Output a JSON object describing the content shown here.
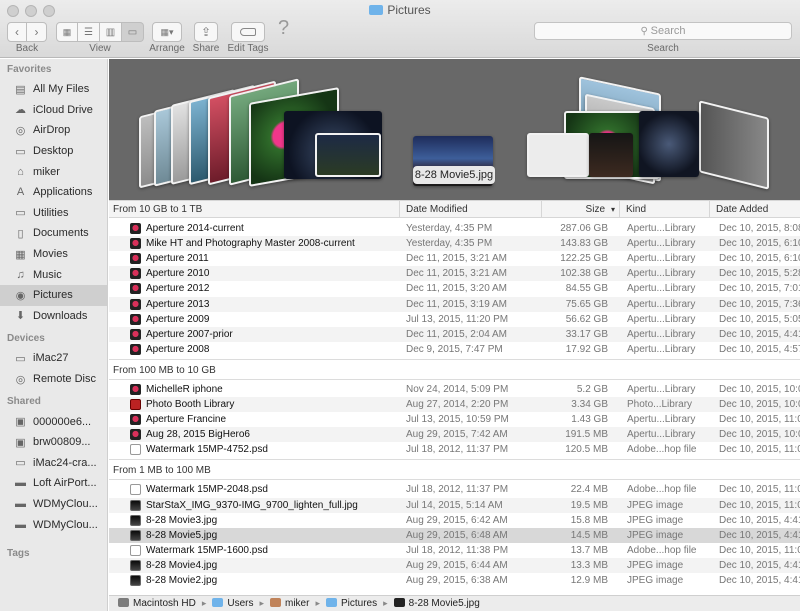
{
  "window": {
    "title": "Pictures"
  },
  "toolbar": {
    "back_label": "Back",
    "view_label": "View",
    "arrange_label": "Arrange",
    "share_label": "Share",
    "edit_tags_label": "Edit Tags",
    "help_glyph": "?",
    "search_placeholder": "Search",
    "search_label": "Search"
  },
  "sidebar": {
    "favorites_title": "Favorites",
    "favorites": [
      {
        "label": "All My Files",
        "icon": "all-files-icon"
      },
      {
        "label": "iCloud Drive",
        "icon": "cloud-icon"
      },
      {
        "label": "AirDrop",
        "icon": "airdrop-icon"
      },
      {
        "label": "Desktop",
        "icon": "desktop-icon"
      },
      {
        "label": "miker",
        "icon": "home-icon"
      },
      {
        "label": "Applications",
        "icon": "applications-icon"
      },
      {
        "label": "Utilities",
        "icon": "folder-icon"
      },
      {
        "label": "Documents",
        "icon": "documents-icon"
      },
      {
        "label": "Movies",
        "icon": "movies-icon"
      },
      {
        "label": "Music",
        "icon": "music-icon"
      },
      {
        "label": "Pictures",
        "icon": "camera-icon",
        "selected": true
      },
      {
        "label": "Downloads",
        "icon": "download-icon"
      }
    ],
    "devices_title": "Devices",
    "devices": [
      {
        "label": "iMac27",
        "icon": "imac-icon"
      },
      {
        "label": "Remote Disc",
        "icon": "disc-icon"
      }
    ],
    "shared_title": "Shared",
    "shared": [
      {
        "label": "000000e6...",
        "icon": "network-pc-icon"
      },
      {
        "label": "brw00809...",
        "icon": "network-pc-icon"
      },
      {
        "label": "iMac24-cra...",
        "icon": "network-imac-icon"
      },
      {
        "label": "Loft AirPort...",
        "icon": "network-device-icon"
      },
      {
        "label": "WDMyClou...",
        "icon": "network-device-icon"
      },
      {
        "label": "WDMyClou...",
        "icon": "network-device-icon"
      }
    ],
    "tags_title": "Tags"
  },
  "coverflow": {
    "caption": "8-28 Movie5.jpg"
  },
  "columns": {
    "name": "From 10 GB to 1 TB",
    "date": "Date Modified",
    "size": "Size",
    "kind": "Kind",
    "added": "Date Added"
  },
  "groups": [
    {
      "title": "From 10 GB to 1 TB",
      "rows": [
        {
          "name": "Aperture 2014-current",
          "date": "Yesterday, 4:35 PM",
          "size": "287.06 GB",
          "kind": "Apertu...Library",
          "added": "Dec 10, 2015, 8:08",
          "icon": "ap"
        },
        {
          "name": "Mike HT and Photography Master 2008-current",
          "date": "Yesterday, 4:35 PM",
          "size": "143.83 GB",
          "kind": "Apertu...Library",
          "added": "Dec 10, 2015, 6:10",
          "icon": "ap"
        },
        {
          "name": "Aperture 2011",
          "date": "Dec 11, 2015, 3:21 AM",
          "size": "122.25 GB",
          "kind": "Apertu...Library",
          "added": "Dec 10, 2015, 6:10",
          "icon": "ap"
        },
        {
          "name": "Aperture 2010",
          "date": "Dec 11, 2015, 3:21 AM",
          "size": "102.38 GB",
          "kind": "Apertu...Library",
          "added": "Dec 10, 2015, 5:28",
          "icon": "ap"
        },
        {
          "name": "Aperture 2012",
          "date": "Dec 11, 2015, 3:20 AM",
          "size": "84.55 GB",
          "kind": "Apertu...Library",
          "added": "Dec 10, 2015, 7:01",
          "icon": "ap"
        },
        {
          "name": "Aperture 2013",
          "date": "Dec 11, 2015, 3:19 AM",
          "size": "75.65 GB",
          "kind": "Apertu...Library",
          "added": "Dec 10, 2015, 7:36",
          "icon": "ap"
        },
        {
          "name": "Aperture 2009",
          "date": "Jul 13, 2015, 11:20 PM",
          "size": "56.62 GB",
          "kind": "Apertu...Library",
          "added": "Dec 10, 2015, 5:05",
          "icon": "ap"
        },
        {
          "name": "Aperture 2007-prior",
          "date": "Dec 11, 2015, 2:04 AM",
          "size": "33.17 GB",
          "kind": "Apertu...Library",
          "added": "Dec 10, 2015, 4:41",
          "icon": "ap"
        },
        {
          "name": "Aperture 2008",
          "date": "Dec 9, 2015, 7:47 PM",
          "size": "17.92 GB",
          "kind": "Apertu...Library",
          "added": "Dec 10, 2015, 4:57",
          "icon": "ap"
        }
      ]
    },
    {
      "title": "From 100 MB to 10 GB",
      "rows": [
        {
          "name": "MichelleR iphone",
          "date": "Nov 24, 2014, 5:09 PM",
          "size": "5.2 GB",
          "kind": "Apertu...Library",
          "added": "Dec 10, 2015, 10:0",
          "icon": "ap"
        },
        {
          "name": "Photo Booth Library",
          "date": "Aug 27, 2014, 2:20 PM",
          "size": "3.34 GB",
          "kind": "Photo...Library",
          "added": "Dec 10, 2015, 10:0",
          "icon": "pb"
        },
        {
          "name": "Aperture Francine",
          "date": "Jul 13, 2015, 10:59 PM",
          "size": "1.43 GB",
          "kind": "Apertu...Library",
          "added": "Dec 10, 2015, 11:0",
          "icon": "ap"
        },
        {
          "name": "Aug 28, 2015 BigHero6",
          "date": "Aug 29, 2015, 7:42 AM",
          "size": "191.5 MB",
          "kind": "Apertu...Library",
          "added": "Dec 10, 2015, 10:0",
          "icon": "ap"
        },
        {
          "name": "Watermark 15MP-4752.psd",
          "date": "Jul 18, 2012, 11:37 PM",
          "size": "120.5 MB",
          "kind": "Adobe...hop file",
          "added": "Dec 10, 2015, 11:0",
          "icon": "doc"
        }
      ]
    },
    {
      "title": "From 1 MB to 100 MB",
      "rows": [
        {
          "name": "Watermark 15MP-2048.psd",
          "date": "Jul 18, 2012, 11:37 PM",
          "size": "22.4 MB",
          "kind": "Adobe...hop file",
          "added": "Dec 10, 2015, 11:0",
          "icon": "doc"
        },
        {
          "name": "StarStaX_IMG_9370-IMG_9700_lighten_full.jpg",
          "date": "Jul 14, 2015, 5:14 AM",
          "size": "19.5 MB",
          "kind": "JPEG image",
          "added": "Dec 10, 2015, 11:0",
          "icon": "img"
        },
        {
          "name": "8-28 Movie3.jpg",
          "date": "Aug 29, 2015, 6:42 AM",
          "size": "15.8 MB",
          "kind": "JPEG image",
          "added": "Dec 10, 2015, 4:41",
          "icon": "img"
        },
        {
          "name": "8-28 Movie5.jpg",
          "date": "Aug 29, 2015, 6:48 AM",
          "size": "14.5 MB",
          "kind": "JPEG image",
          "added": "Dec 10, 2015, 4:41",
          "icon": "img",
          "selected": true
        },
        {
          "name": "Watermark 15MP-1600.psd",
          "date": "Jul 18, 2012, 11:38 PM",
          "size": "13.7 MB",
          "kind": "Adobe...hop file",
          "added": "Dec 10, 2015, 11:0",
          "icon": "doc"
        },
        {
          "name": "8-28 Movie4.jpg",
          "date": "Aug 29, 2015, 6:44 AM",
          "size": "13.3 MB",
          "kind": "JPEG image",
          "added": "Dec 10, 2015, 4:41",
          "icon": "img"
        },
        {
          "name": "8-28 Movie2.jpg",
          "date": "Aug 29, 2015, 6:38 AM",
          "size": "12.9 MB",
          "kind": "JPEG image",
          "added": "Dec 10, 2015, 4:41",
          "icon": "img"
        }
      ]
    }
  ],
  "pathbar": [
    "Macintosh HD",
    "Users",
    "miker",
    "Pictures",
    "8-28 Movie5.jpg"
  ],
  "colors": {
    "selection_gray": "#d8d8d8",
    "coverflow_bg": "#686868",
    "sidebar_bg": "#e9e9e9"
  }
}
